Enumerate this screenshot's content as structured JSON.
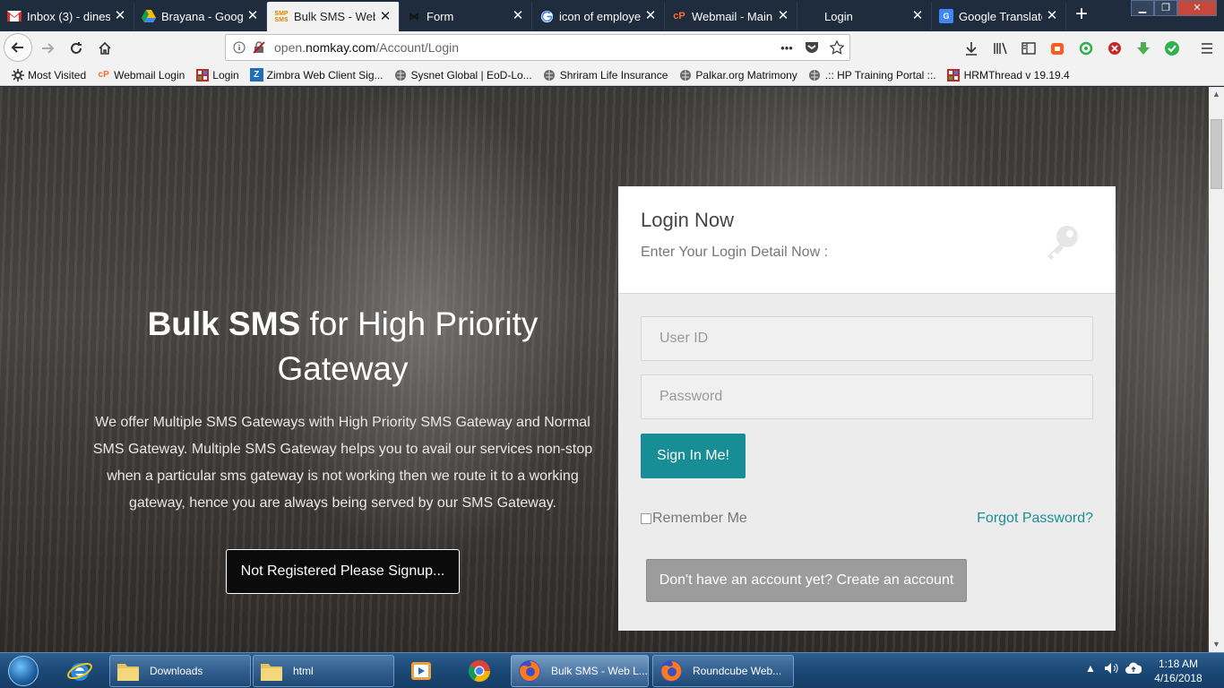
{
  "browser": {
    "tabs": [
      {
        "label": "Inbox (3) - dines",
        "icon": "gmail-icon",
        "close": "✕"
      },
      {
        "label": "Brayana - Googl",
        "icon": "google-drive-icon",
        "close": "✕"
      },
      {
        "label": "Bulk SMS - Web",
        "icon": "sms-logo-icon",
        "close": "✕"
      },
      {
        "label": "Form",
        "icon": "form-icon",
        "close": "✕"
      },
      {
        "label": "icon of employe",
        "icon": "google-icon",
        "close": "✕"
      },
      {
        "label": "Webmail - Main",
        "icon": "cpanel-icon",
        "close": "✕"
      },
      {
        "label": "Login",
        "icon": "blank-page-icon",
        "close": "✕"
      },
      {
        "label": "Google Translate",
        "icon": "google-translate-icon",
        "close": "✕"
      }
    ],
    "new_tab": "+",
    "url_host": "open.",
    "url_domain": "nomkay.com",
    "url_path": "/Account/Login",
    "url_more": "•••"
  },
  "bookmarks": [
    {
      "label": "Most Visited",
      "icon": "gear-icon"
    },
    {
      "label": "Webmail Login",
      "icon": "cpanel-icon"
    },
    {
      "label": "Login",
      "icon": "grid-icon"
    },
    {
      "label": "Zimbra Web Client Sig...",
      "icon": "zimbra-icon"
    },
    {
      "label": "Sysnet Global | EoD-Lo...",
      "icon": "globe-icon"
    },
    {
      "label": "Shriram Life Insurance",
      "icon": "globe-icon"
    },
    {
      "label": "Palkar.org Matrimony",
      "icon": "globe-icon"
    },
    {
      "label": ".:: HP Training Portal ::.",
      "icon": "globe-icon"
    },
    {
      "label": "HRMThread v 19.19.4",
      "icon": "grid-icon"
    }
  ],
  "hero": {
    "title_bold": "Bulk SMS",
    "title_rest": " for High Priority Gateway",
    "description": "We offer Multiple SMS Gateways with High Priority SMS Gateway and Normal SMS Gateway. Multiple SMS Gateway helps you to avail our services non-stop when a particular sms gateway is not working then we route it to a working gateway, hence you are always being served by our SMS Gateway.",
    "signup_button": "Not Registered Please Signup..."
  },
  "login": {
    "title": "Login Now",
    "subtitle": "Enter Your Login Detail Now :",
    "user_placeholder": "User ID",
    "password_placeholder": "Password",
    "signin_button": "Sign In Me!",
    "remember_label": "Remember Me",
    "forgot_link": "Forgot Password?",
    "create_account_button": "Don't have an account yet? Create an account"
  },
  "taskbar": {
    "items": [
      {
        "label": "Downloads",
        "icon": "folder-icon"
      },
      {
        "label": "html",
        "icon": "folder-icon"
      },
      {
        "label": "Bulk SMS - Web L...",
        "icon": "firefox-icon"
      },
      {
        "label": "Roundcube Web...",
        "icon": "firefox-icon"
      }
    ],
    "time": "1:18 AM",
    "date": "4/16/2018"
  },
  "colors": {
    "accent_teal": "#178d96",
    "link_teal": "#1b8f97",
    "browser_chrome": "#1e2c3d"
  }
}
